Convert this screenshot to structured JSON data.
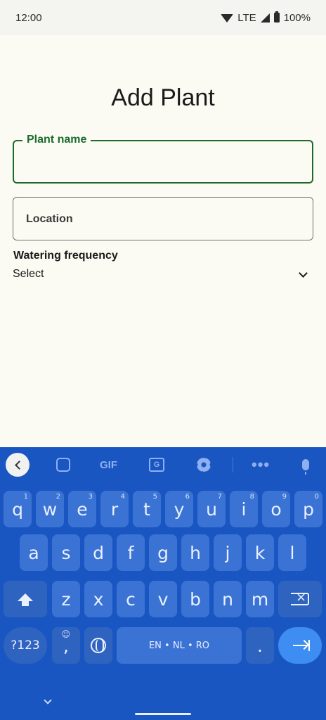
{
  "status_bar": {
    "time": "12:00",
    "network": "LTE",
    "battery": "100%"
  },
  "page": {
    "title": "Add Plant"
  },
  "form": {
    "plant_name": {
      "label": "Plant name",
      "value": ""
    },
    "location": {
      "label": "Location",
      "value": ""
    },
    "watering": {
      "label": "Watering frequency",
      "selected": "Select"
    }
  },
  "keyboard": {
    "toolbar": {
      "gif": "GIF"
    },
    "row1": [
      {
        "k": "q",
        "h": "1"
      },
      {
        "k": "w",
        "h": "2"
      },
      {
        "k": "e",
        "h": "3"
      },
      {
        "k": "r",
        "h": "4"
      },
      {
        "k": "t",
        "h": "5"
      },
      {
        "k": "y",
        "h": "6"
      },
      {
        "k": "u",
        "h": "7"
      },
      {
        "k": "i",
        "h": "8"
      },
      {
        "k": "o",
        "h": "9"
      },
      {
        "k": "p",
        "h": "0"
      }
    ],
    "row2": [
      "a",
      "s",
      "d",
      "f",
      "g",
      "h",
      "j",
      "k",
      "l"
    ],
    "row3": [
      "z",
      "x",
      "c",
      "v",
      "b",
      "n",
      "m"
    ],
    "symbols": "?123",
    "emoji_comma": ",",
    "space": "EN • NL • RO",
    "period": "."
  }
}
